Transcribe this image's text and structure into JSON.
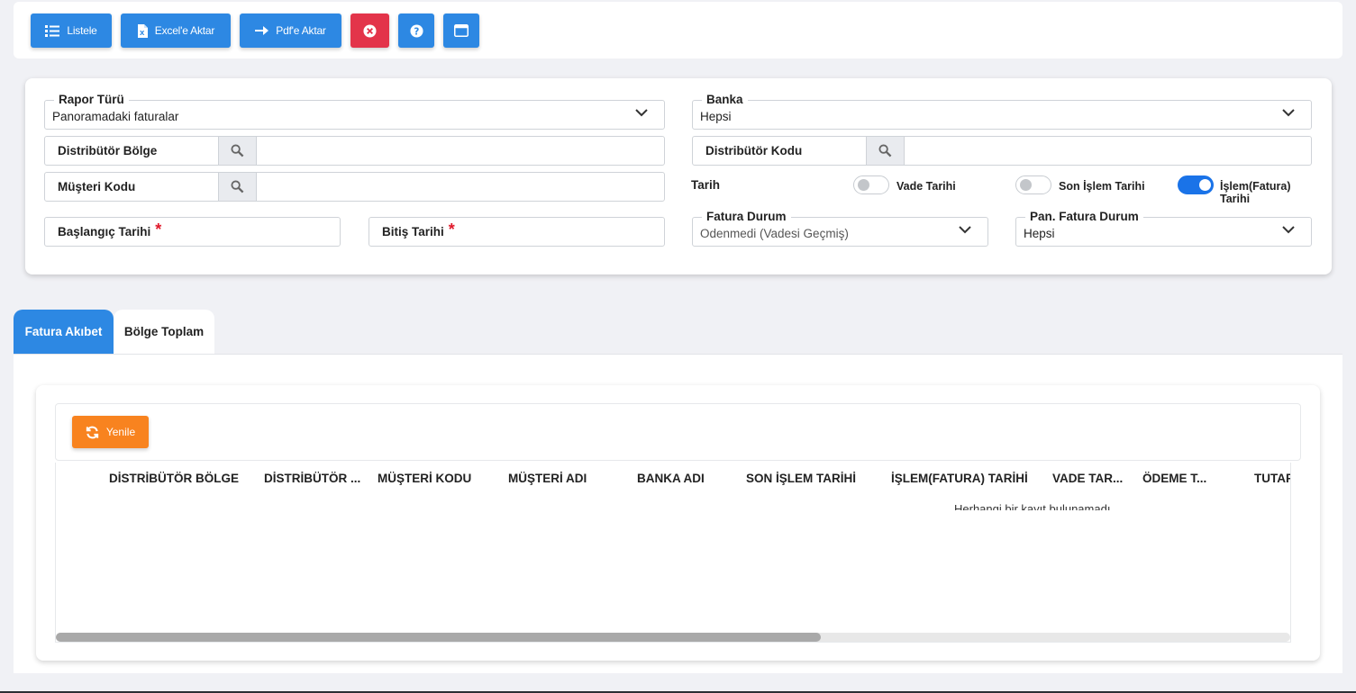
{
  "toolbar": {
    "listele": "Listele",
    "excel": "Excel'e Aktar",
    "pdf": "Pdf'e Aktar",
    "icons": {
      "listele": "list-icon",
      "excel": "excel-file-icon",
      "pdf": "arrow-right-icon",
      "close": "close-circle-icon",
      "help": "help-circle-icon",
      "window": "window-icon"
    }
  },
  "filters": {
    "rapor_turu": {
      "label": "Rapor Türü",
      "value": "Panoramadaki faturalar"
    },
    "banka": {
      "label": "Banka",
      "value": "Hepsi"
    },
    "distributor_bolge": {
      "label": "Distribütör Bölge",
      "value": ""
    },
    "distributor_kodu": {
      "label": "Distribütör Kodu",
      "value": ""
    },
    "musteri_kodu": {
      "label": "Müşteri Kodu",
      "value": ""
    },
    "tarih_label": "Tarih",
    "vade_tarihi": {
      "label": "Vade Tarihi",
      "on": false
    },
    "son_islem_tarihi": {
      "label": "Son İşlem Tarihi",
      "on": false
    },
    "islem_fatura_tarihi": {
      "label_line1": "İşlem(Fatura)",
      "label_line2": "Tarihi",
      "on": true
    },
    "baslangic_tarihi": {
      "label": "Başlangıç Tarihi",
      "required": "*"
    },
    "bitis_tarihi": {
      "label": "Bitiş Tarihi",
      "required": "*"
    },
    "fatura_durum": {
      "label": "Fatura Durum",
      "value": "Odenmedi (Vadesi Geçmiş)"
    },
    "pan_fatura_durum": {
      "label": "Pan. Fatura Durum",
      "value": "Hepsi"
    }
  },
  "tabs": [
    {
      "label": "Fatura Akıbet",
      "active": true
    },
    {
      "label": "Bölge Toplam",
      "active": false
    }
  ],
  "grid": {
    "refresh_label": "Yenile",
    "columns": [
      "DİSTRİBÜTÖR BÖLGE",
      "DİSTRİBÜTÖR ...",
      "MÜŞTERİ KODU",
      "MÜŞTERİ ADI",
      "BANKA ADI",
      "SON İŞLEM TARİHİ",
      "İŞLEM(FATURA) TARİHİ",
      "VADE TAR...",
      "ÖDEME T...",
      "TUTAR"
    ],
    "empty_text": "Herhangi bir kayıt bulunamadı",
    "scroll_fraction": 0.62
  },
  "colors": {
    "primary": "#2d88e3",
    "danger": "#e3344a",
    "warning": "#f8831f",
    "toggle_on": "#1a73e8"
  }
}
